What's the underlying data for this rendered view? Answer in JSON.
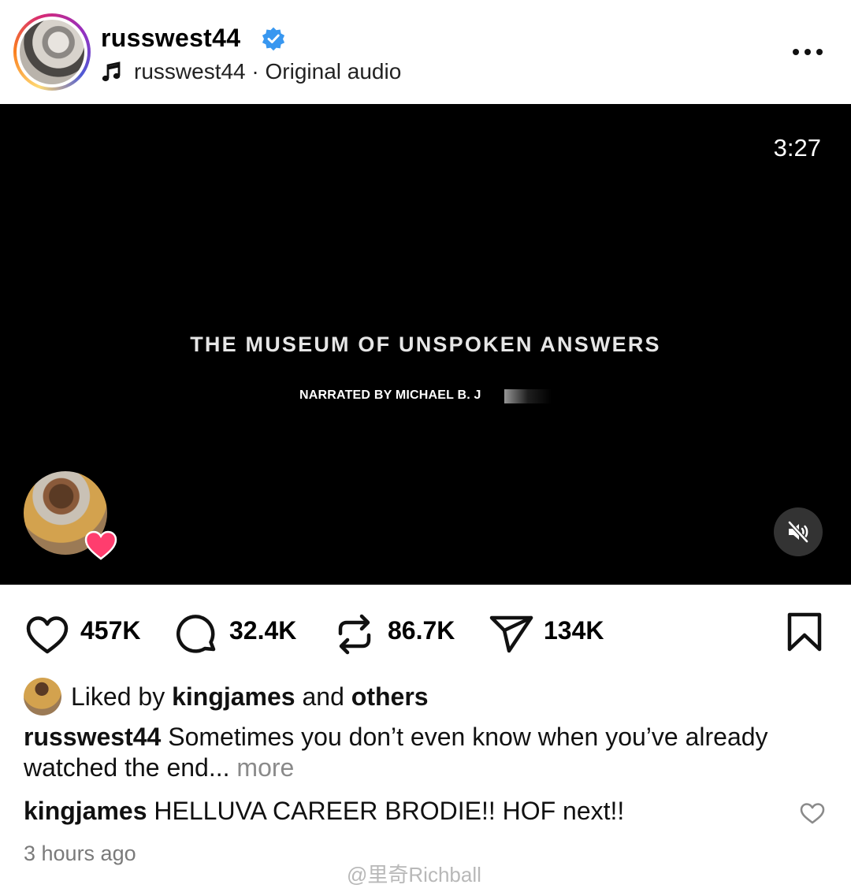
{
  "post": {
    "username": "russwest44",
    "audio_owner": "russwest44",
    "audio_separator": "·",
    "audio_label": "Original audio"
  },
  "video": {
    "duration": "3:27",
    "title": "THE MUSEUM OF UNSPOKEN ANSWERS",
    "subtitle": "NARRATED BY MICHAEL B. J"
  },
  "stats": {
    "likes": "457K",
    "comments": "32.4K",
    "reposts": "86.7K",
    "shares": "134K"
  },
  "liked_by": {
    "prefix": "Liked by",
    "user": "kingjames",
    "conjunction": "and",
    "suffix": "others"
  },
  "caption": {
    "user": "russwest44",
    "text": "Sometimes you don’t even know when you’ve already watched the end...",
    "more": "more"
  },
  "comment": {
    "user": "kingjames",
    "text": "HELLUVA CAREER BRODIE!! HOF next!!"
  },
  "timestamp": "3 hours ago",
  "watermark": "@里奇Richball",
  "colors": {
    "verified": "#3897f0",
    "heart_badge": "#ff3d6e",
    "video_bg": "#000000",
    "muted_text": "#8a8a8a"
  },
  "icons": [
    "verified-badge-icon",
    "music-note-icon",
    "more-options-icon",
    "mute-icon",
    "heart-icon",
    "comment-icon",
    "repost-icon",
    "share-icon",
    "bookmark-icon"
  ]
}
